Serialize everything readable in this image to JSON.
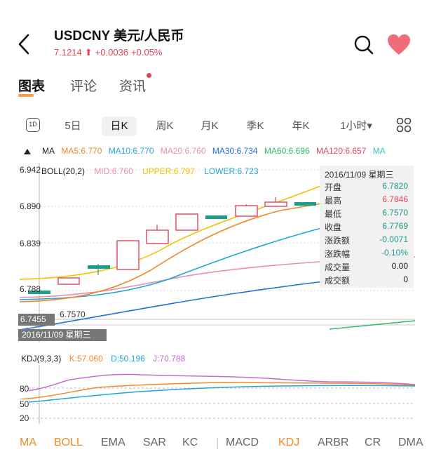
{
  "header": {
    "title": "USDCNY 美元/人民币",
    "price": "7.1214",
    "arrow": "⬆",
    "change": "+0.0036",
    "change_pct": "+0.05%"
  },
  "tabs": {
    "chart": "图表",
    "comments": "评论",
    "news": "资讯"
  },
  "periods": {
    "one_d": "1D",
    "five_day": "5日",
    "day_k": "日K",
    "week_k": "周K",
    "month_k": "月K",
    "quarter_k": "季K",
    "year_k": "年K",
    "hour": "1小时▾"
  },
  "ma": {
    "label": "MA",
    "ma5": "MA5:6.770",
    "ma10": "MA10:6.770",
    "ma20": "MA20:6.760",
    "ma30": "MA30:6.734",
    "ma60": "MA60:6.696",
    "ma120": "MA120:6.657",
    "more": "MA"
  },
  "boll": {
    "label": "BOLL(20,2)",
    "mid": "MID:6.760",
    "upper": "UPPER:6.797",
    "lower": "LOWER:6.723"
  },
  "price_axis": {
    "p1": "6.942",
    "p2": "6.890",
    "p3": "6.839",
    "p4": "6.788",
    "current": "6.7455",
    "low_marker": "6.7570",
    "date_marker": "2016/11/09 星期三"
  },
  "info_panel": {
    "date": "2016/11/09 星期三",
    "rows": [
      {
        "k": "开盘",
        "v": "6.7820"
      },
      {
        "k": "最高",
        "v": "6.7846"
      },
      {
        "k": "最低",
        "v": "6.7570"
      },
      {
        "k": "收盘",
        "v": "6.7769"
      },
      {
        "k": "涨跌额",
        "v": "-0.0071"
      },
      {
        "k": "涨跌幅",
        "v": "-0.10%"
      },
      {
        "k": "成交量",
        "v": "0.00"
      },
      {
        "k": "成交额",
        "v": "0"
      }
    ]
  },
  "kdj": {
    "label": "KDJ(9,3,3)",
    "k": "K:57.060",
    "d": "D:50.196",
    "j": "J:70.788",
    "ticks": [
      "80",
      "50",
      "20"
    ]
  },
  "indicators": {
    "ma": "MA",
    "boll": "BOLL",
    "ema": "EMA",
    "sar": "SAR",
    "kc": "KC",
    "macd": "MACD",
    "kdj": "KDJ",
    "arbr": "ARBR",
    "cr": "CR",
    "dma": "DMA"
  },
  "colors": {
    "up": "#e0455c",
    "down": "#1a9e8e",
    "ma5": "#f08a2a",
    "ma10": "#1fa7d6",
    "ma20": "#e68fb0",
    "ma30": "#1f6fd6",
    "ma60": "#2fb96a",
    "ma120": "#e0455c",
    "boll_upper": "#f2c200",
    "accent": "#f08a2a"
  }
}
